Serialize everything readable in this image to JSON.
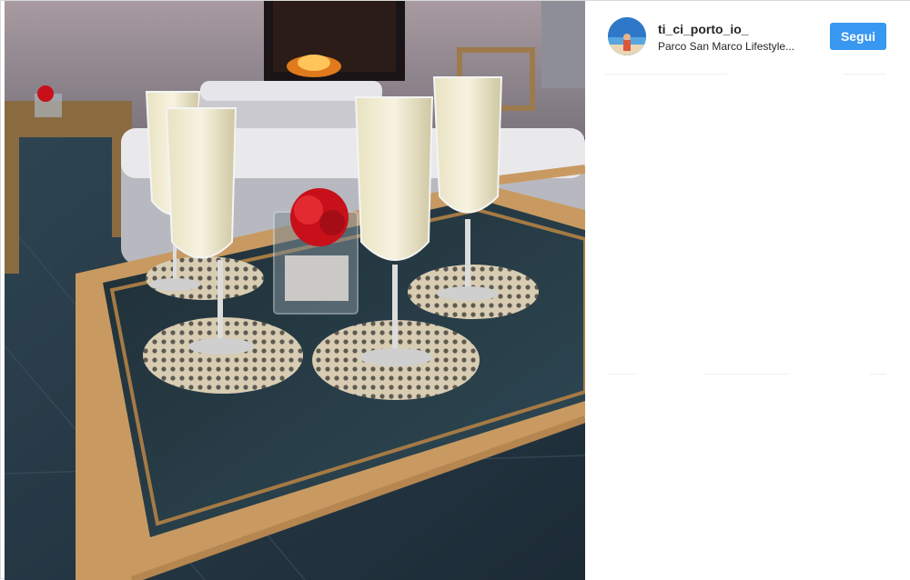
{
  "post": {
    "username": "ti_ci_porto_io_",
    "location": "Parco San Marco Lifestyle...",
    "follow_label": "Segui"
  },
  "photo": {
    "subject": "champagne-glasses-on-glass-table",
    "icon": "photo-image"
  },
  "colors": {
    "follow_button": "#3897f0",
    "text": "#262626",
    "divider": "#efefef"
  }
}
